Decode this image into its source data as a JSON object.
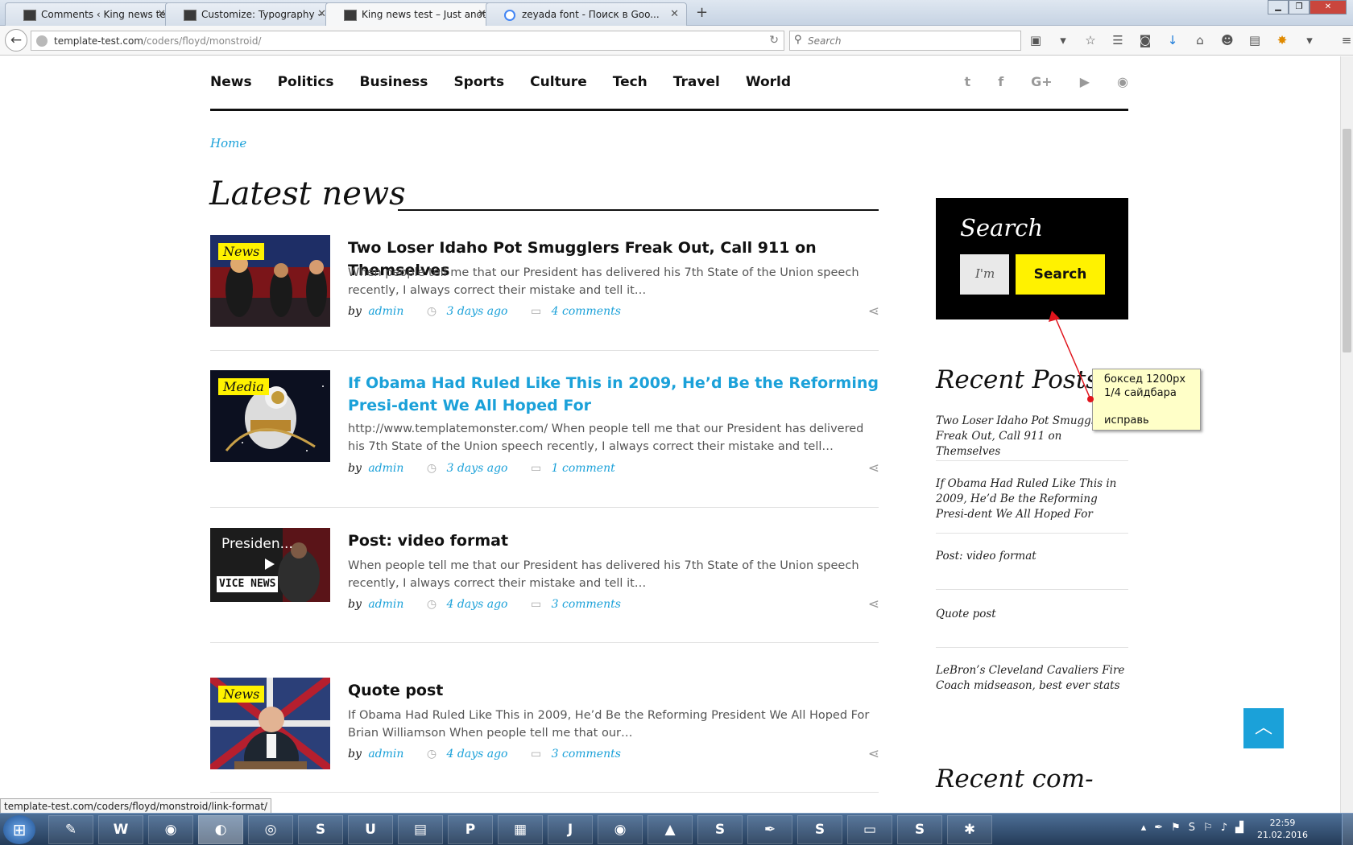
{
  "browser": {
    "tabs": [
      {
        "label": "Comments ‹ King news tes...",
        "icon": "wp-icon"
      },
      {
        "label": "Customize: Typography – ...",
        "icon": "wp-icon"
      },
      {
        "label": "King news test – Just anoth...",
        "icon": "wp-icon"
      },
      {
        "label": "zeyada font - Поиск в Goo...",
        "icon": "google-icon"
      }
    ],
    "new_tab": "+",
    "url_host": "template-test.com",
    "url_path": "/coders/floyd/monstroid/",
    "search_placeholder": "Search",
    "status_url": "template-test.com/coders/floyd/monstroid/link-format/"
  },
  "site": {
    "nav": [
      "News",
      "Politics",
      "Business",
      "Sports",
      "Culture",
      "Tech",
      "Travel",
      "World"
    ],
    "social": [
      "twitter-icon",
      "facebook-icon",
      "google-plus-icon",
      "youtube-icon",
      "rss-icon"
    ],
    "breadcrumb": "Home",
    "section_title": "Latest news"
  },
  "posts": [
    {
      "badge": "News",
      "title": "Two Loser Idaho Pot Smugglers Freak Out, Call 911 on Themselves",
      "excerpt": "When people tell me that our President has delivered his 7th State of the Union speech recently, I always correct their mistake and tell it…",
      "by": "by",
      "author": "admin",
      "date": "3 days ago",
      "comments": "4 comments"
    },
    {
      "badge": "Media",
      "title": "If Obama Had Ruled Like This in 2009, He’d Be the Reforming Presi-dent We All Hoped For",
      "excerpt": "http://www.templatemonster.com/ When people tell me that our President has delivered his 7th State of the Union speech recently, I always correct their mistake and tell…",
      "by": "by",
      "author": "admin",
      "date": "3 days ago",
      "comments": "1 comment"
    },
    {
      "badge": "",
      "video_title": "Presiden...",
      "video_brand": "VICE NEWS",
      "title": "Post: video format",
      "excerpt": "When people tell me that our President has delivered his 7th State of the Union speech recently, I always correct their mistake and tell it…",
      "by": "by",
      "author": "admin",
      "date": "4 days ago",
      "comments": "3 comments"
    },
    {
      "badge": "News",
      "title": "Quote post",
      "excerpt": "If Obama Had Ruled Like This in 2009, He’d Be the Reforming President We All Hoped For Brian Williamson When people tell me that our…",
      "by": "by",
      "author": "admin",
      "date": "4 days ago",
      "comments": "3 comments"
    }
  ],
  "sidebar": {
    "search_title": "Search",
    "search_value": "I'm",
    "search_button": "Search",
    "recent_title": "Recent Posts",
    "recent_items": [
      "Two Loser Idaho Pot Smugglers Freak Out, Call 911 on Themselves",
      "If Obama Had Ruled Like This in 2009, He’d Be the Reforming Presi-dent We All Hoped For",
      "Post: video format",
      "Quote post",
      "LeBron’s Cleveland Cavaliers Fire Coach midseason, best ever stats"
    ],
    "recent_comments_title": "Recent com-"
  },
  "annotation": {
    "line1": "боксед 1200px",
    "line2": "1/4 сайдбара",
    "line3": "исправь"
  },
  "taskbar": {
    "apps": [
      "notepad-icon",
      "wot-icon",
      "chrome-icon",
      "firefox-icon",
      "eye-icon",
      "sublime-icon",
      "icon-u",
      "floppy-icon",
      "pdf-icon",
      "calculator-icon",
      "jetbrains-icon",
      "chrome-icon",
      "avast-icon",
      "s-icon",
      "feather-icon",
      "skype-s-icon",
      "folder-icon",
      "skype-icon",
      "bug-icon"
    ],
    "time": "22:59",
    "date": "21.02.2016"
  },
  "colors": {
    "accent": "#1ba1d9",
    "badge": "#fff200",
    "dark": "#111111"
  }
}
